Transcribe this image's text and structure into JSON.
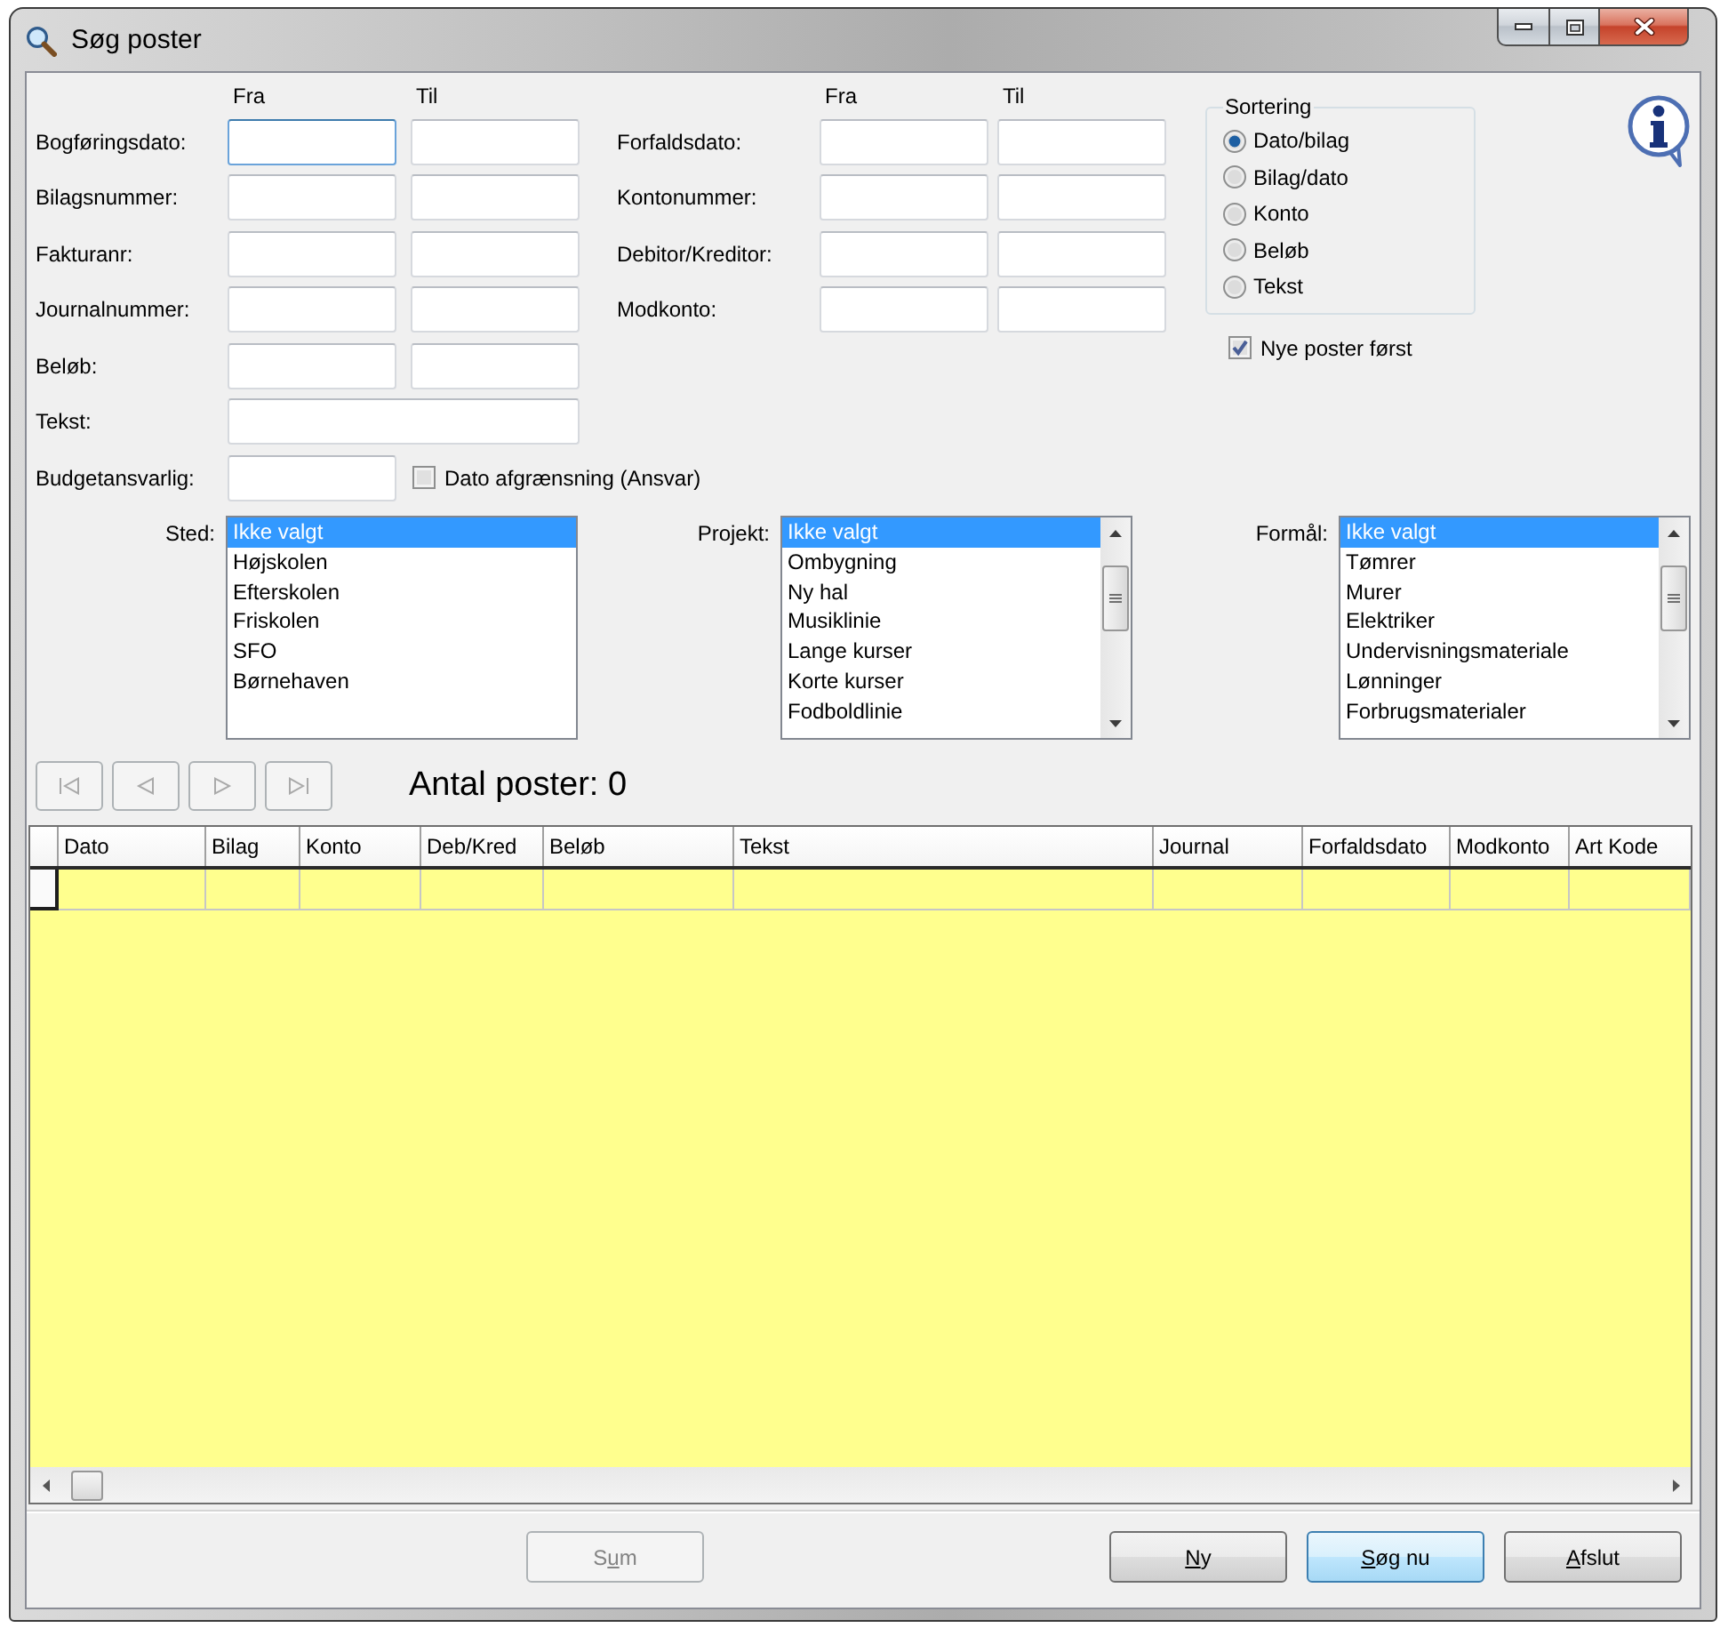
{
  "window": {
    "title": "Søg poster"
  },
  "date_filters": {
    "headers": [
      "Fra",
      "Til"
    ],
    "rows": [
      {
        "label": "Bogføringsdato:",
        "kind": "range",
        "focused": true
      },
      {
        "label": "Bilagsnummer:",
        "kind": "range",
        "focused": false
      },
      {
        "label": "Fakturanr:",
        "kind": "range",
        "focused": false
      },
      {
        "label": "Journalnummer:",
        "kind": "range",
        "focused": false
      },
      {
        "label": "Beløb:",
        "kind": "range",
        "focused": false
      },
      {
        "label": "Tekst:",
        "kind": "wide",
        "focused": false
      },
      {
        "label": "Budgetansvarlig:",
        "kind": "single",
        "focused": false,
        "checkbox": {
          "label": "Dato afgrænsning (Ansvar)",
          "checked": false
        }
      }
    ]
  },
  "account_filters": {
    "headers": [
      "Fra",
      "Til"
    ],
    "rows": [
      {
        "label": "Forfaldsdato:",
        "kind": "range",
        "focused": false
      },
      {
        "label": "Kontonummer:",
        "kind": "range",
        "focused": false
      },
      {
        "label": "Debitor/Kreditor:",
        "kind": "range",
        "focused": false
      },
      {
        "label": "Modkonto:",
        "kind": "range",
        "focused": false
      }
    ]
  },
  "sorting": {
    "title": "Sortering",
    "options": [
      {
        "label": "Dato/bilag",
        "selected": true
      },
      {
        "label": "Bilag/dato",
        "selected": false
      },
      {
        "label": "Konto",
        "selected": false
      },
      {
        "label": "Beløb",
        "selected": false
      },
      {
        "label": "Tekst",
        "selected": false
      }
    ],
    "newest_first": {
      "label": "Nye poster først",
      "checked": true
    }
  },
  "lists": [
    {
      "label": "Sted:",
      "scrollable": false,
      "items": [
        {
          "label": "Ikke valgt",
          "selected": true
        },
        {
          "label": "Højskolen",
          "selected": false
        },
        {
          "label": "Efterskolen",
          "selected": false
        },
        {
          "label": "Friskolen",
          "selected": false
        },
        {
          "label": "SFO",
          "selected": false
        },
        {
          "label": "Børnehaven",
          "selected": false
        }
      ]
    },
    {
      "label": "Projekt:",
      "scrollable": true,
      "items": [
        {
          "label": "Ikke valgt",
          "selected": true
        },
        {
          "label": "Ombygning",
          "selected": false
        },
        {
          "label": "Ny hal",
          "selected": false
        },
        {
          "label": "Musiklinie",
          "selected": false
        },
        {
          "label": "Lange kurser",
          "selected": false
        },
        {
          "label": "Korte kurser",
          "selected": false
        },
        {
          "label": "Fodboldlinie",
          "selected": false
        }
      ]
    },
    {
      "label": "Formål:",
      "scrollable": true,
      "items": [
        {
          "label": "Ikke valgt",
          "selected": true
        },
        {
          "label": "Tømrer",
          "selected": false
        },
        {
          "label": "Murer",
          "selected": false
        },
        {
          "label": "Elektriker",
          "selected": false
        },
        {
          "label": "Undervisningsmateriale",
          "selected": false
        },
        {
          "label": "Lønninger",
          "selected": false
        },
        {
          "label": "Forbrugsmaterialer",
          "selected": false
        }
      ]
    }
  ],
  "navigation": {
    "buttons": [
      {
        "kind": "first",
        "disabled": true
      },
      {
        "kind": "previous",
        "disabled": true
      },
      {
        "kind": "next",
        "disabled": true
      },
      {
        "kind": "last",
        "disabled": true
      }
    ],
    "count": "Antal poster: 0"
  },
  "grid": {
    "columns": [
      "Dato",
      "Bilag",
      "Konto",
      "Deb/Kred",
      "Beløb",
      "Tekst",
      "Journal",
      "Forfaldsdato",
      "Modkonto",
      "Art Kode"
    ]
  },
  "buttons": [
    {
      "label_start": "S",
      "access_key": "u",
      "label_end": "m",
      "disabled": true,
      "default": false
    },
    {
      "access_key": "N",
      "label_end": "y",
      "disabled": false,
      "default": false
    },
    {
      "access_key": "S",
      "label_end": "øg nu",
      "disabled": false,
      "default": true
    },
    {
      "access_key": "A",
      "label_end": "fslut",
      "disabled": false,
      "default": false
    }
  ]
}
